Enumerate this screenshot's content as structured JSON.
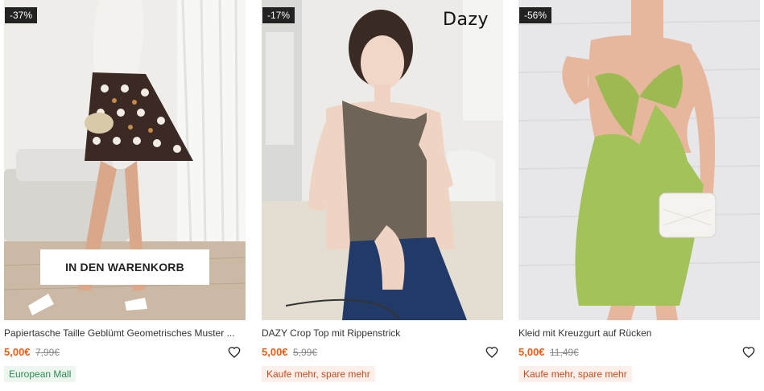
{
  "products": [
    {
      "discount": "-37%",
      "cart_button": "IN DEN WARENKORB",
      "title": "Papiertasche Taille Geblümt Geometrisches Muster ...",
      "price": "5,00€",
      "old_price": "7,99€",
      "tag": "European Mall",
      "tag_color": "#2c8a4e"
    },
    {
      "discount": "-17%",
      "brand_logo": "Dazy",
      "title": "DAZY Crop Top mit Rippenstrick",
      "price": "5,00€",
      "old_price": "5,99€",
      "tag": "Kaufe mehr, spare mehr",
      "tag_color": "#c44a1b"
    },
    {
      "discount": "-56%",
      "title": "Kleid mit Kreuzgurt auf Rücken",
      "price": "5,00€",
      "old_price": "11,49€",
      "tag": "Kaufe mehr, spare mehr",
      "tag_color": "#c44a1b"
    }
  ],
  "icons": {
    "wishlist": "heart-icon"
  },
  "colors": {
    "price": "#f55b10",
    "badge_bg": "#222222"
  }
}
